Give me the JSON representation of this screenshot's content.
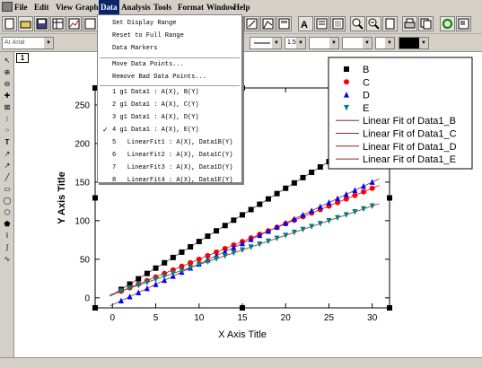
{
  "menu": {
    "items": [
      "File",
      "Edit",
      "View",
      "Graph",
      "Data",
      "Analysis",
      "Tools",
      "Format",
      "Window",
      "Help"
    ],
    "active": "Data"
  },
  "data_menu": {
    "items": [
      {
        "label": "Set Display Range",
        "checked": false
      },
      {
        "label": "Reset to Full Range",
        "checked": false
      },
      {
        "label": "Data Markers",
        "checked": false
      },
      {
        "label": "Move Data Points...",
        "checked": false
      },
      {
        "label": "Remove Bad Data Points...",
        "checked": false
      },
      {
        "label": "1 g1 Data1 : A(X), B(Y)",
        "checked": false
      },
      {
        "label": "2 g1 Data1 : A(X), C(Y)",
        "checked": false
      },
      {
        "label": "3 g1 Data1 : A(X), D(Y)",
        "checked": false
      },
      {
        "label": "4 g1 Data1 : A(X), E(Y)",
        "checked": true
      },
      {
        "label": "5   LinearFit1 : A(X), Data1B(Y)",
        "checked": false
      },
      {
        "label": "6   LinearFit2 : A(X), Data1C(Y)",
        "checked": false
      },
      {
        "label": "7   LinearFit3 : A(X), Data1D(Y)",
        "checked": false
      },
      {
        "label": "8   LinearFit4 : A(X), Data1E(Y)",
        "checked": false
      }
    ]
  },
  "toolbar": {
    "font_combo": "Ar Arial",
    "line_width": "1.5",
    "check_mark": "✓"
  },
  "layer_tab": "1",
  "colors": {
    "B": "#000000",
    "C": "#ff0000",
    "D": "#0000ff",
    "E": "#008080",
    "fit": "#8b2a2a"
  },
  "chart_data": {
    "type": "scatter",
    "xlabel": "X Axis Title",
    "ylabel": "Y Axis Title",
    "xlim": [
      -2,
      32
    ],
    "ylim": [
      -13,
      272
    ],
    "xticks": [
      0,
      5,
      10,
      15,
      20,
      25,
      30
    ],
    "yticks": [
      0,
      50,
      100,
      150,
      200,
      250
    ],
    "x": [
      1,
      2,
      3,
      4,
      5,
      6,
      7,
      8,
      9,
      10,
      11,
      12,
      13,
      14,
      15,
      16,
      17,
      18,
      19,
      20,
      21,
      22,
      23,
      24,
      25,
      26,
      27,
      28,
      29,
      30
    ],
    "series": [
      {
        "name": "B",
        "marker": "square",
        "color": "#000000",
        "slope": 6.9,
        "intercept": 4
      },
      {
        "name": "C",
        "marker": "circle",
        "color": "#ff0000",
        "slope": 4.6,
        "intercept": 4
      },
      {
        "name": "D",
        "marker": "triangle-up",
        "color": "#0000ff",
        "slope": 5.3,
        "intercept": -9
      },
      {
        "name": "E",
        "marker": "triangle-down",
        "color": "#008080",
        "slope": 3.8,
        "intercept": 5
      }
    ],
    "fits": [
      {
        "name": "Linear Fit of Data1_B",
        "slope": 6.9,
        "intercept": 4
      },
      {
        "name": "Linear Fit of Data1_C",
        "slope": 4.6,
        "intercept": 4
      },
      {
        "name": "Linear Fit of Data1_D",
        "slope": 5.3,
        "intercept": -9
      },
      {
        "name": "Linear Fit of Data1_E",
        "slope": 3.8,
        "intercept": 5
      }
    ],
    "legend": {
      "placement": "top-right",
      "entries": [
        "B",
        "C",
        "D",
        "E",
        "Linear Fit of Data1_B",
        "Linear Fit of Data1_C",
        "Linear Fit of Data1_D",
        "Linear Fit of Data1_E"
      ]
    }
  }
}
